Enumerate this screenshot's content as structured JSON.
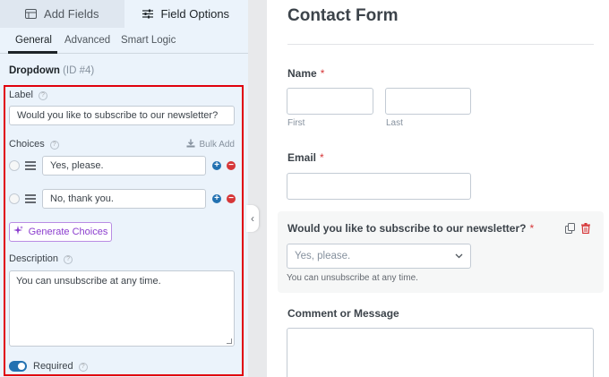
{
  "panel": {
    "tabs": [
      {
        "label": "Add Fields",
        "icon": "table-list-icon"
      },
      {
        "label": "Field Options",
        "icon": "sliders-icon"
      }
    ],
    "subtabs": [
      "General",
      "Advanced",
      "Smart Logic"
    ],
    "field_name": "Dropdown",
    "field_id": "(ID #4)",
    "label_title": "Label",
    "label_value": "Would you like to subscribe to our newsletter?",
    "choices_title": "Choices",
    "bulk_add": "Bulk Add",
    "choices": [
      "Yes, please.",
      "No, thank you."
    ],
    "generate_button": "Generate Choices",
    "description_title": "Description",
    "description_value": "You can unsubscribe at any time.",
    "required_label": "Required",
    "required_on": true,
    "accent_color": "#2271b1",
    "highlight_color": "#e0000c"
  },
  "preview": {
    "form_title": "Contact Form",
    "name": {
      "label": "Name",
      "required_mark": "*",
      "first": "First",
      "last": "Last"
    },
    "email": {
      "label": "Email",
      "required_mark": "*"
    },
    "dropdown": {
      "label": "Would you like to subscribe to our newsletter?",
      "required_mark": "*",
      "selected": "Yes, please.",
      "hint": "You can unsubscribe at any time."
    },
    "comment": {
      "label": "Comment or Message"
    }
  }
}
